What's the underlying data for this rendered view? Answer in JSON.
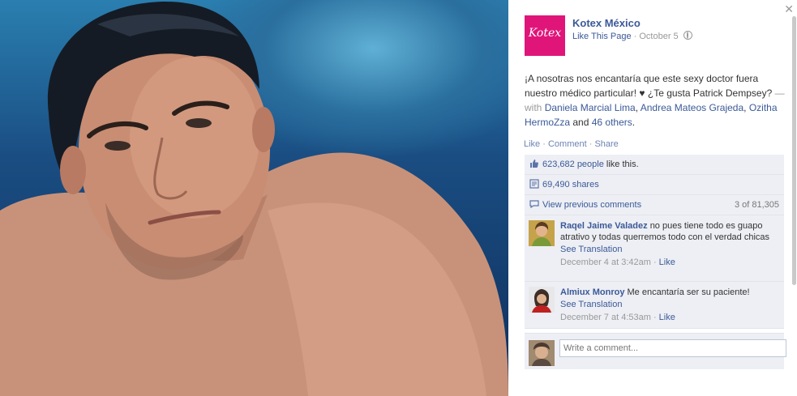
{
  "photo": {
    "alt": "Shirtless man in swimming pool"
  },
  "panel": {
    "close_icon": "close-icon",
    "page": {
      "logo_text": "Kotex",
      "logo_color": "#e0157a",
      "name": "Kotex México",
      "like_link": "Like This Page",
      "date": "October 5",
      "privacy_icon": "globe-icon"
    },
    "post": {
      "text": "¡A nosotras nos encantaría que este sexy doctor fuera nuestro médico particular! ♥ ¿Te gusta Patrick Dempsey?",
      "with_sep": " — with ",
      "tags": [
        "Daniela Marcial Lima",
        "Andrea Mateos Grajeda",
        "Ozitha HermoZza"
      ],
      "and": " and ",
      "others": "46 others",
      "end": "."
    },
    "actions": {
      "like": "Like",
      "comment": "Comment",
      "share": "Share",
      "sep": " · "
    },
    "likes": {
      "count": "623,682 people",
      "suffix": " like this.",
      "icon": "thumbs-up-icon"
    },
    "shares": {
      "count": "69,490 shares",
      "icon": "share-icon"
    },
    "previous": {
      "label": "View previous comments",
      "counter": "3 of 81,305",
      "icon": "comment-icon"
    },
    "comments": [
      {
        "name": "Raqel Jaime Valadez",
        "text": "no pues tiene todo es guapo atrativo y todas querremos todo con el verdad chicas",
        "translate": "See Translation",
        "time": "December 4 at 3:42am",
        "like": "Like"
      },
      {
        "name": "Almiux Monroy",
        "text": "Me encantaría ser su paciente!",
        "translate": "See Translation",
        "time": "December 7 at 4:53am",
        "like": "Like"
      }
    ],
    "write": {
      "placeholder": "Write a comment..."
    },
    "colors": {
      "link": "#3b5998",
      "ufi_bg": "#edeff4"
    }
  }
}
